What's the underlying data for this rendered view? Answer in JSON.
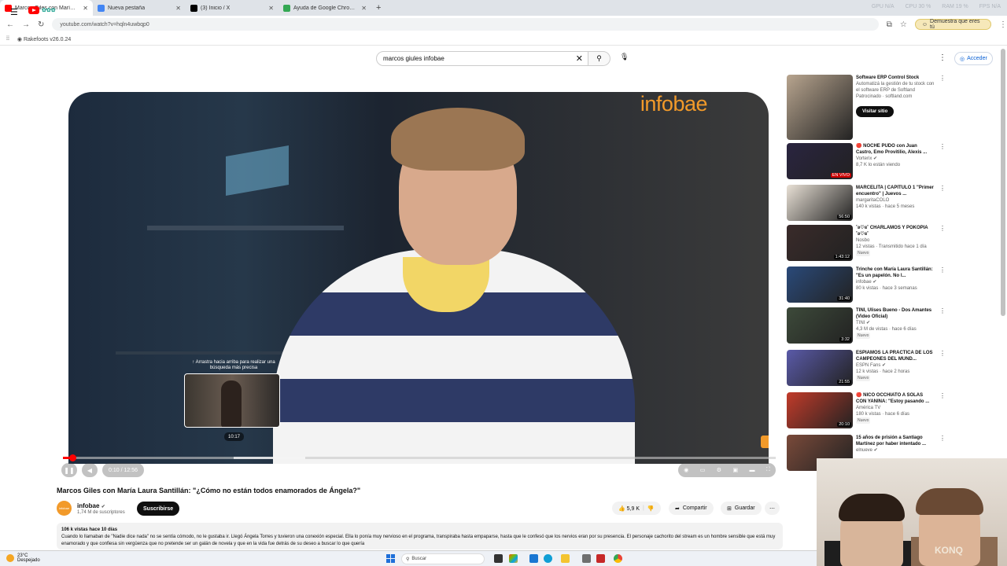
{
  "browser": {
    "tabs": [
      {
        "label": "Marcos Giles con María Lau",
        "active": true,
        "fav_color": "#ff0000"
      },
      {
        "label": "Nueva pestaña",
        "active": false,
        "fav_color": "#4285f4"
      },
      {
        "label": "(3) Inicio / X",
        "active": false,
        "fav_color": "#000000"
      },
      {
        "label": "Ayuda de Google Chrome",
        "active": false,
        "fav_color": "#34a853"
      }
    ],
    "meters": [
      "GPU N/A",
      "CPU 30 %",
      "RAM 19 %",
      "FPS N/A"
    ],
    "url": "youtube.com/watch?v=hqln4uwbqp0",
    "profile_label": "Demuestra que eres tú",
    "bookmark": "Rakefoots v26.0.24"
  },
  "youtube": {
    "search_value": "marcos giules infobae",
    "signin_label": "Acceder"
  },
  "player": {
    "brand": "infobae",
    "seek_hint": "↑ Arrastra hacia arriba para realizar una búsqueda más precisa",
    "preview_time": "10:17",
    "time_display": "0:10 / 12:56",
    "progress_fraction": 0.013,
    "buffer_start": 0.24,
    "buffer_end": 0.34
  },
  "video": {
    "title": "Marcos Giles con María Laura Santillán: \"¿Cómo no están todos enamorados de Ángela?\"",
    "channel": "infobae",
    "channel_logo": "infobae",
    "subscribers": "1,74 M de suscriptores",
    "subscribe_label": "Suscribirse",
    "likes": "5,9 K",
    "share_label": "Compartir",
    "save_label": "Guardar",
    "desc_meta": "106 k vistas hace 10 días",
    "desc_text": "Cuando lo llamaban de \"Nadie dice nada\" no se sentía cómodo, no le gustaba ir. Llegó Ángela Torres y tuvieron una conexión especial. Ella lo ponía muy nervioso en el programa, transpiraba hasta empaparse, hasta que le confesó que los nervios eran por su presencia. El personaje cachorito del stream es un hombre sensible que está muy enamorado y que confiesa sin vergüenza que no pretende ser un galán de novela y que en la vida fue detrás de su deseo a buscar lo que quería"
  },
  "recommendations": [
    {
      "title": "Software ERP Control Stock",
      "line2": "Automatizá la gestión de tu stock con el software ERP de Softland",
      "line3": "Patrocinado · softland.com",
      "badge": "",
      "color": "#b8a58f",
      "ad": true,
      "visit_label": "Visitar sitio"
    },
    {
      "title": "🔴 NOCHE PUDO con Juan Castro, Emo Provitilio, Alexis ...",
      "line2": "Vorterix ✔",
      "line3": "8,7 K lo están viendo",
      "badge": "EN VIVO",
      "color": "#2a2440"
    },
    {
      "title": "MARCELITA | CAPÍTULO 1 \"Primer encuentro\" | Juevos ...",
      "line2": "margaritaCOLO",
      "line3": "140 k vistas · hace 5 meses",
      "badge": "56:50",
      "color": "#e9e1d6"
    },
    {
      "title": "˚ʚ♡ɞ˚ CHARLAMOS Y POKOPIA ˚ʚ♡ɞ˚",
      "line2": "Nosbo",
      "line3": "12 vistas · Transmitido hace 1 día",
      "badge": "1:43:12",
      "color": "#3a2b2a",
      "nuevo": "Nuevo"
    },
    {
      "title": "Trinche con María Laura Santillán: \"Es un papelón. No l...",
      "line2": "infobae ✔",
      "line3": "80 k vistas · hace 3 semanas",
      "badge": "31:40",
      "color": "#2a4a7a"
    },
    {
      "title": "TINI, Ulises Bueno - Dos Amantes (Video Oficial)",
      "line2": "TINI ✔",
      "line3": "4,3 M de vistas · hace 6 días",
      "badge": "3:32",
      "color": "#3d4a3a",
      "nuevo": "Nuevo"
    },
    {
      "title": "ESPIAMOS LA PRÁCTICA DE LOS CAMPEONES DEL MUND...",
      "line2": "ESPN Fans ✔",
      "line3": "12 k vistas · hace 2 horas",
      "badge": "21:55",
      "color": "#5a5aa8",
      "nuevo": "Nuevo"
    },
    {
      "title": "🔴 NICO OCCHIATO A SOLAS CON YANINA: \"Estoy pasando ...",
      "line2": "América TV",
      "line3": "180 k vistas · hace 6 días",
      "badge": "20:10",
      "color": "#c23b2a",
      "nuevo": "Nuevo"
    },
    {
      "title": "15 años de prisión a Santiago Martínez por haber intentado ...",
      "line2": "elnueve ✔",
      "line3": "",
      "badge": "",
      "color": "#7a4a3a"
    }
  ],
  "webcam": {
    "shirt_text": "KONQ"
  },
  "taskbar": {
    "temp": "23°C",
    "weather": "Despejado",
    "search_label": "Buscar"
  },
  "colors": {
    "accent": "#ff0000",
    "brand_orange": "#f29a2a"
  }
}
